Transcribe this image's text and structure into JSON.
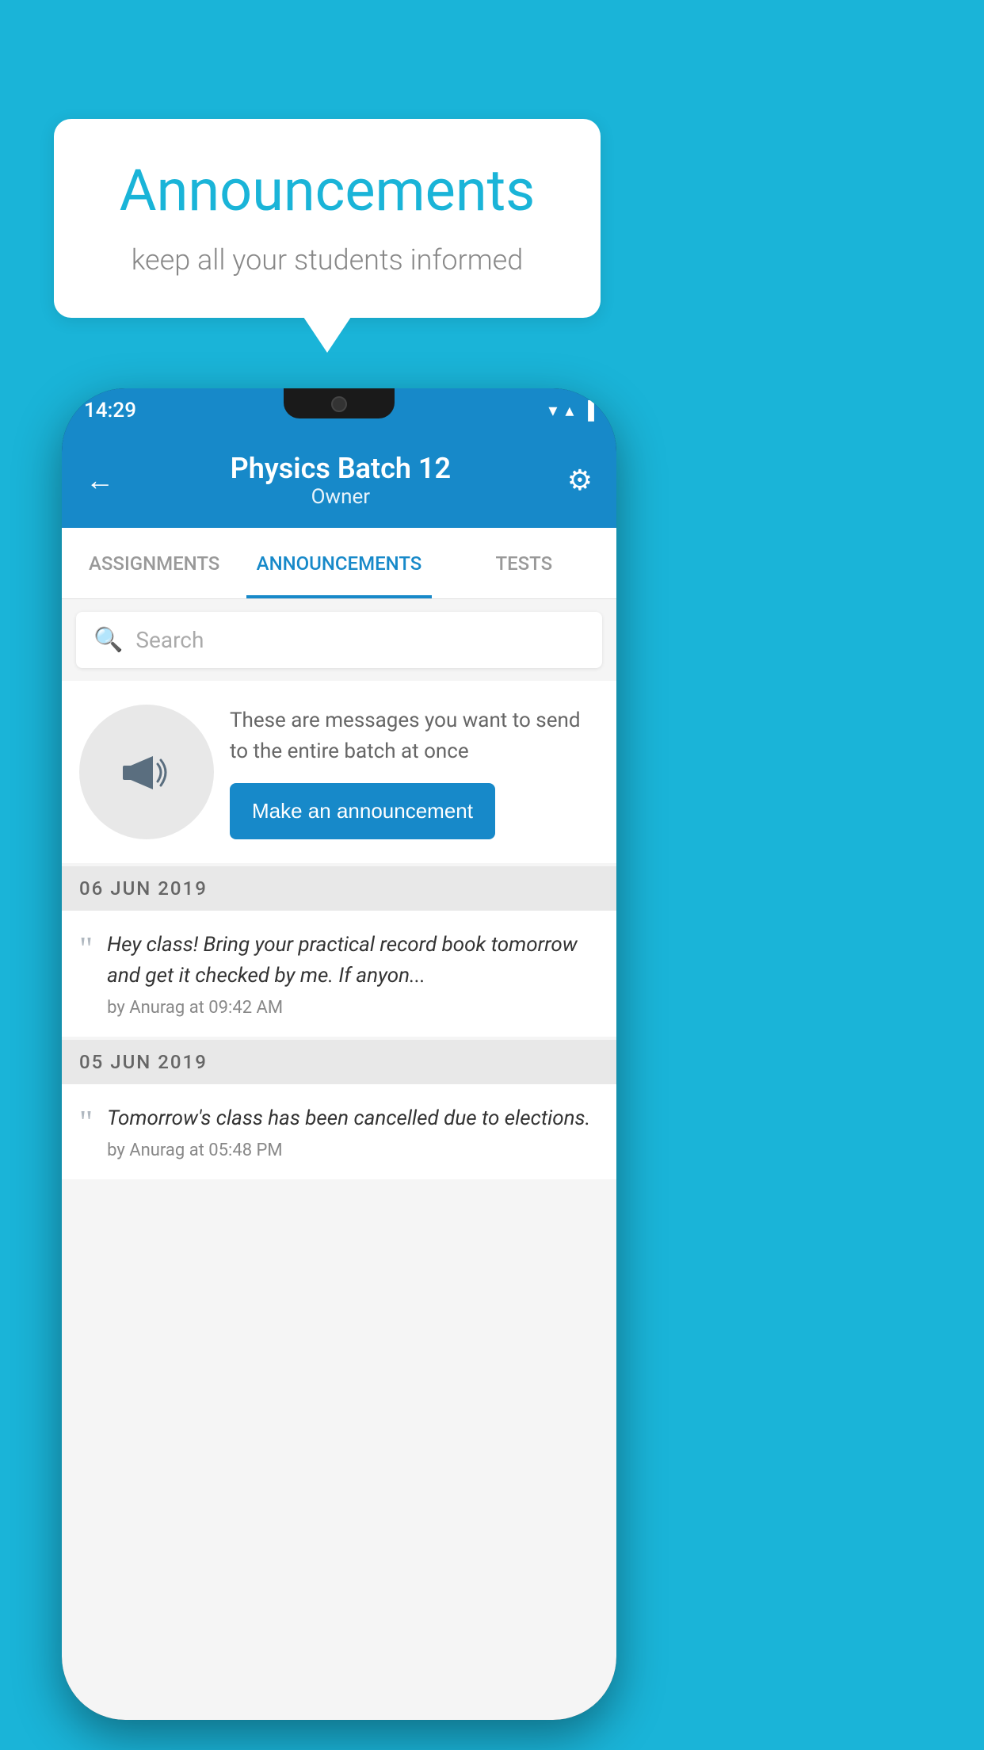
{
  "background_color": "#1ab4d8",
  "speech_bubble": {
    "title": "Announcements",
    "subtitle": "keep all your students informed"
  },
  "phone": {
    "status_bar": {
      "time": "14:29",
      "wifi": "▼",
      "signal": "▲",
      "battery": "▌"
    },
    "header": {
      "back_label": "←",
      "title": "Physics Batch 12",
      "subtitle": "Owner",
      "gear_label": "⚙"
    },
    "tabs": [
      {
        "label": "ASSIGNMENTS",
        "active": false
      },
      {
        "label": "ANNOUNCEMENTS",
        "active": true
      },
      {
        "label": "TESTS",
        "active": false
      },
      {
        "label": "•••",
        "active": false
      }
    ],
    "search": {
      "placeholder": "Search"
    },
    "promo": {
      "message": "These are messages you want to send to the entire batch at once",
      "button_label": "Make an announcement"
    },
    "announcements": [
      {
        "date": "06  JUN  2019",
        "text": "Hey class! Bring your practical record book tomorrow and get it checked by me. If anyon...",
        "meta": "by Anurag at 09:42 AM"
      },
      {
        "date": "05  JUN  2019",
        "text": "Tomorrow's class has been cancelled due to elections.",
        "meta": "by Anurag at 05:48 PM"
      }
    ]
  }
}
